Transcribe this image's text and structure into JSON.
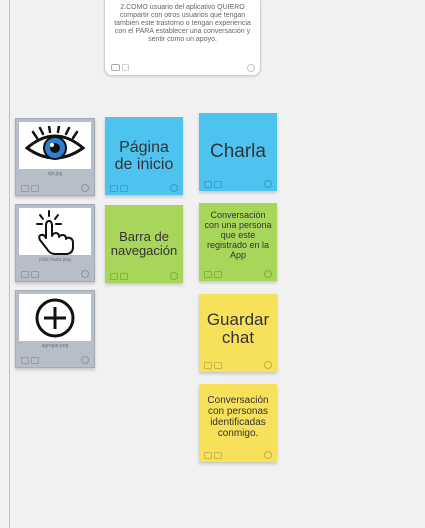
{
  "story": {
    "text": "2.COMO usuario del aplicativo QUIERO compartir con otros usuarios que tengan también este trastorno o tengan experiencia con el PARA establecer una conversación y sentir como un apoyo."
  },
  "images": [
    {
      "caption": "ojo.jpg",
      "icon": "eye-icon"
    },
    {
      "caption": "click hada.png",
      "icon": "pointer-hand-icon"
    },
    {
      "caption": "agregar.png",
      "icon": "add-circle-icon"
    }
  ],
  "notes": {
    "home": {
      "label": "Página de inicio",
      "color": "#4fc3f0"
    },
    "navbar": {
      "label": "Barra de navegación",
      "color": "#a8d65a"
    },
    "chat": {
      "label": "Charla",
      "color": "#4fc3f0"
    },
    "conversation": {
      "label": "Conversación con una persona que este registrado en la App",
      "color": "#a8d65a"
    },
    "save_chat": {
      "label": "Guardar chat",
      "color": "#f7e15b"
    },
    "identified": {
      "label": "Conversación con personas identificadas conmigo.",
      "color": "#f7e15b"
    }
  }
}
